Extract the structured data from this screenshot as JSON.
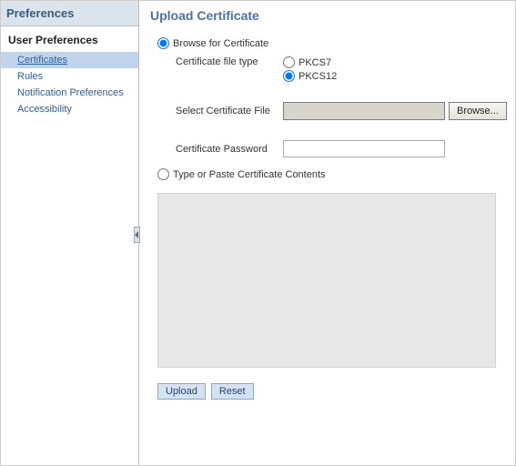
{
  "sidebar": {
    "title": "Preferences",
    "section": "User Preferences",
    "items": [
      {
        "label": "Certificates",
        "selected": true
      },
      {
        "label": "Rules",
        "selected": false
      },
      {
        "label": "Notification Preferences",
        "selected": false
      },
      {
        "label": "Accessibility",
        "selected": false
      }
    ]
  },
  "page": {
    "title": "Upload Certificate",
    "mode": {
      "browse_label": "Browse for Certificate",
      "paste_label": "Type or Paste Certificate Contents",
      "selected": "browse"
    },
    "fields": {
      "filetype_label": "Certificate file type",
      "filetype_options": {
        "pkcs7": "PKCS7",
        "pkcs12": "PKCS12"
      },
      "filetype_selected": "pkcs12",
      "select_file_label": "Select Certificate File",
      "browse_button": "Browse...",
      "file_value": "",
      "password_label": "Certificate Password",
      "password_value": ""
    },
    "paste_value": "",
    "actions": {
      "upload": "Upload",
      "reset": "Reset"
    }
  }
}
